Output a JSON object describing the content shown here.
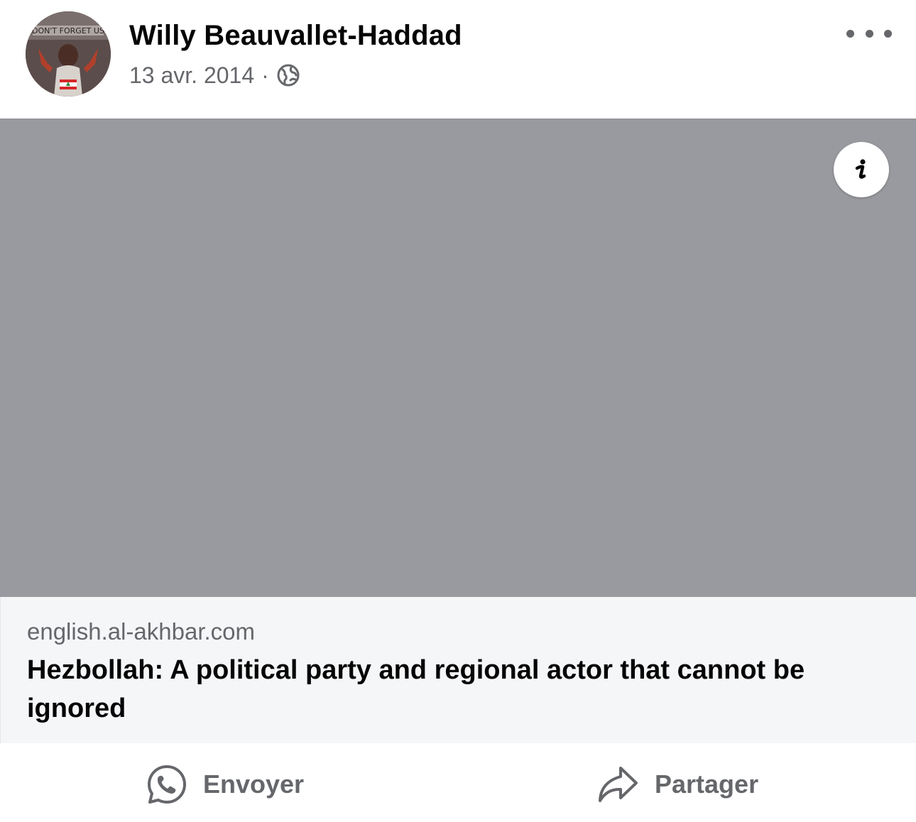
{
  "post": {
    "author_name": "Willy Beauvallet-Haddad",
    "date": "13 avr. 2014",
    "separator": "·",
    "privacy_icon": "globe-icon",
    "more_icon": "more-horizontal-icon",
    "avatar_text": "DON'T FORGET US"
  },
  "link_preview": {
    "image_placeholder_color": "#989a9f",
    "info_icon": "info-icon",
    "domain": "english.al-akhbar.com",
    "title": "Hezbollah: A political party and regional actor that cannot be ignored"
  },
  "actions": {
    "send": {
      "label": "Envoyer",
      "icon": "whatsapp-icon"
    },
    "share": {
      "label": "Partager",
      "icon": "share-arrow-icon"
    }
  },
  "colors": {
    "text_primary": "#050505",
    "text_secondary": "#65676b",
    "preview_background": "#f5f6f8"
  }
}
